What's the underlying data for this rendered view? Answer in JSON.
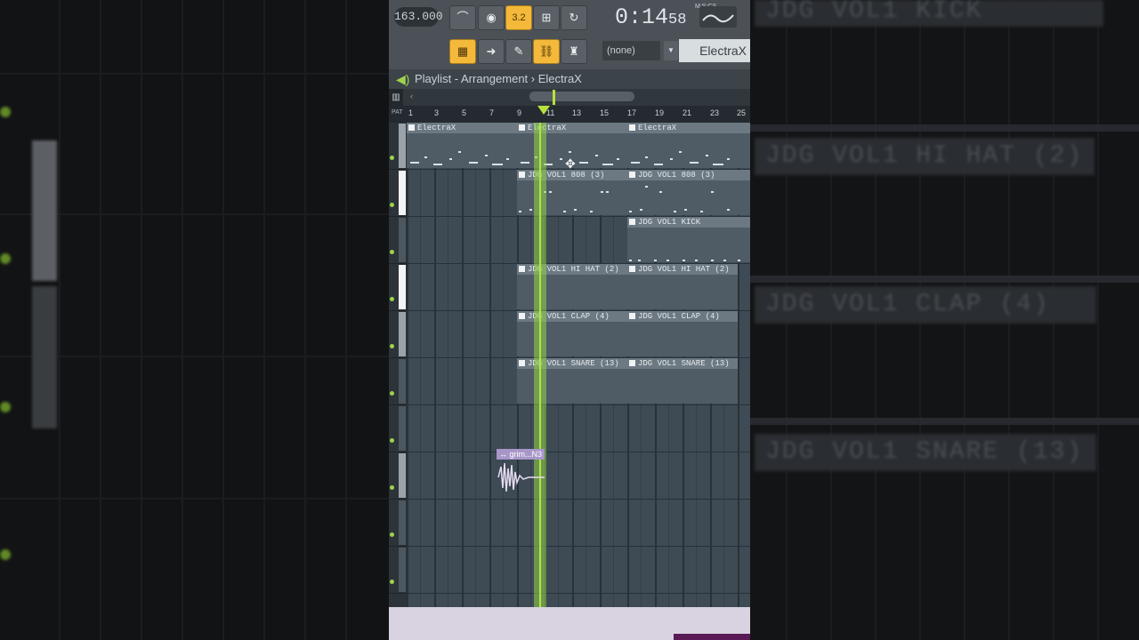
{
  "toolbar": {
    "tempo": "163.000",
    "pattern_button_label": "3.2",
    "time": "0:14",
    "time_sub": "58",
    "time_unit": "M:S:CS",
    "pattern_select": "(none)",
    "pattern_name": "ElectraX"
  },
  "playlist": {
    "title": "Playlist - Arrangement › ElectraX",
    "pat_label": "PAT",
    "ruler": [
      "1",
      "3",
      "5",
      "7",
      "9",
      "11",
      "13",
      "15",
      "17",
      "19",
      "21",
      "23",
      "25"
    ]
  },
  "clips": {
    "electrax_1": "ElectraX",
    "electrax_2": "ElectraX",
    "electrax_3": "ElectraX",
    "e808_1": "JDG VOL1 808 (3)",
    "e808_2": "JDG VOL1 808 (3)",
    "kick": "JDG VOL1 KICK",
    "hihat_1": "JDG VOL1 HI HAT (2)",
    "hihat_2": "JDG VOL1 HI HAT (2)",
    "clap_1": "JDG VOL1 CLAP (4)",
    "clap_2": "JDG VOL1 CLAP (4)",
    "snare_1": "JDG VOL1 SNARE (13)",
    "snare_2": "JDG VOL1 SNARE (13)",
    "audio": "grim...N3"
  },
  "background": {
    "kick": "JDG VOL1 KICK",
    "hihat": "JDG VOL1 HI HAT (2)",
    "clap": "JDG VOL1 CLAP (4)",
    "snare": "JDG VOL1 SNARE (13)"
  },
  "colors": {
    "accent_green": "#b6e23c",
    "button_orange": "#f4b93a",
    "audio_clip": "#a896c8"
  }
}
